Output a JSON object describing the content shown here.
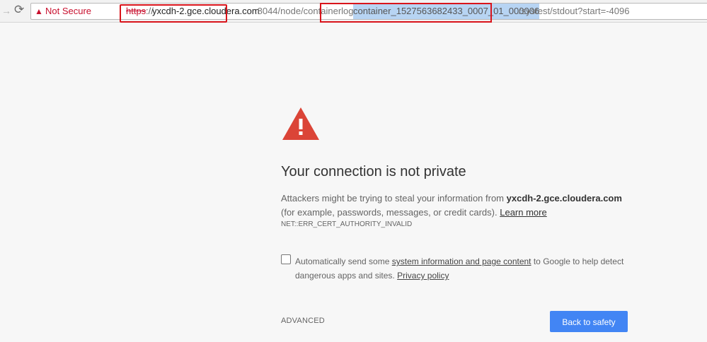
{
  "toolbar": {
    "forward_glyph": "→",
    "reload_glyph": "⟳",
    "security_icon": "warning-triangle-icon",
    "security_label": "Not Secure",
    "url": {
      "scheme": "https",
      "scheme_sep": "://",
      "host": "yxcdh-2.gce.cloudera.com",
      "path_before": ":8044/node/containerlogs/",
      "container_id": "container_1527563682433_0007_01_000006",
      "path_after": "/systest/stdout?start=-4096"
    }
  },
  "interstitial": {
    "icon": "warning-triangle-icon",
    "heading": "Your connection is not private",
    "message_prefix": "Attackers might be trying to steal your information from ",
    "host": "yxcdh-2.gce.cloudera.com",
    "message_suffix": " (for example, passwords, messages, or credit cards). ",
    "learn_more": "Learn more",
    "error_code": "NET::ERR_CERT_AUTHORITY_INVALID",
    "report": {
      "checked": false,
      "text_before": "Automatically send some ",
      "link_system_info": "system information and page content",
      "text_middle": " to Google to help detect dangerous apps and sites. ",
      "link_privacy": "Privacy policy"
    },
    "advanced_label": "ADVANCED",
    "back_button_label": "Back to safety"
  },
  "colors": {
    "accent": "#4285f4",
    "warning": "#db4437",
    "not_secure": "#c8102e",
    "annotation": "#d9141b"
  }
}
